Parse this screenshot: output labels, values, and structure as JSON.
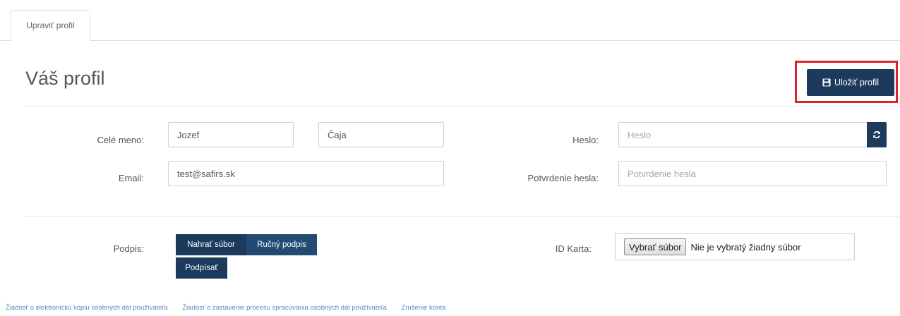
{
  "tabs": [
    {
      "label": "Upraviť profil"
    }
  ],
  "page": {
    "title": "Váš profil"
  },
  "toolbar": {
    "save_label": "Uložiť profil"
  },
  "form": {
    "full_name": {
      "label": "Celé meno:",
      "first_name": "Jozef",
      "last_name": "Čaja"
    },
    "email": {
      "label": "Email:",
      "value": "test@safirs.sk"
    },
    "password": {
      "label": "Heslo:",
      "placeholder": "Heslo"
    },
    "password_confirm": {
      "label": "Potvrdenie hesla:",
      "placeholder": "Potvrdenie hesla"
    },
    "signature": {
      "label": "Podpis:",
      "upload_label": "Nahrať súbor",
      "manual_label": "Ručný podpis",
      "sign_label": "Podpísať"
    },
    "id_card": {
      "label": "ID Karta:",
      "choose_label": "Vybrať súbor",
      "status": "Nie je vybratý žiadny súbor"
    }
  },
  "footer": {
    "links": [
      "Žiadosť o elektronickú kópiu osobných dát používateľa",
      "Žiadosť o zastavenie procesu spracúvania osobných dát používateľa",
      "Zrušenie konta"
    ]
  },
  "colors": {
    "primary": "#1b3a5c",
    "highlight": "#d9262e",
    "link": "#5a8cbf"
  },
  "icons": {
    "save": "floppy-disk-icon",
    "refresh": "refresh-icon"
  }
}
